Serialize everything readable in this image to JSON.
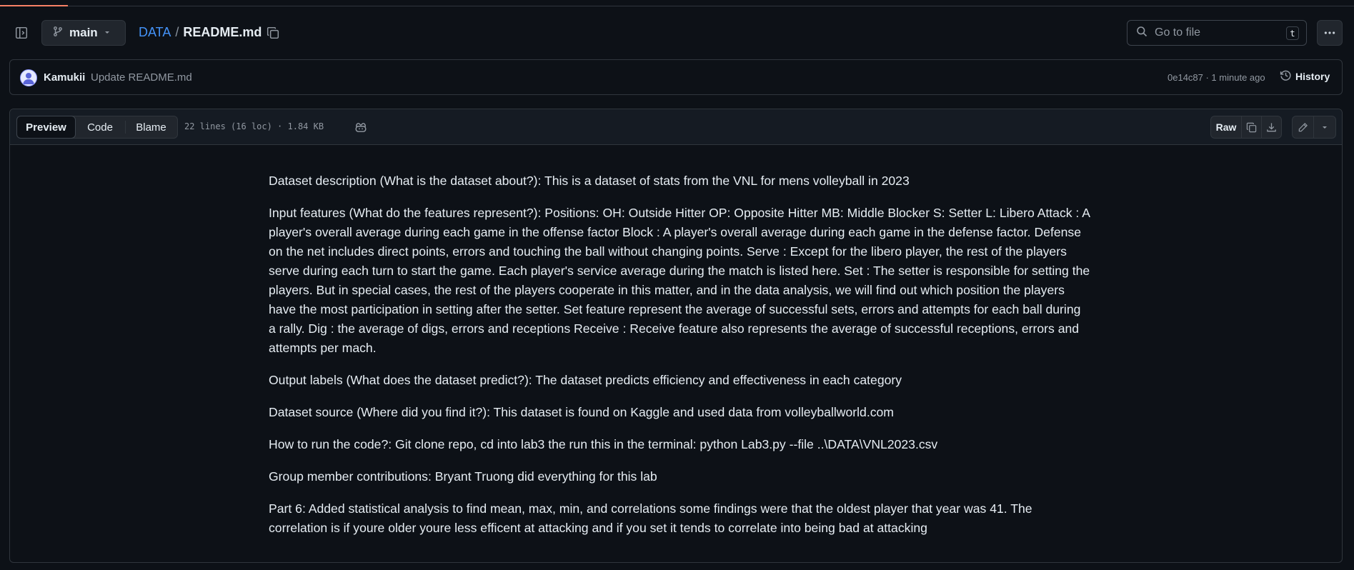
{
  "header": {
    "branch_label": "main",
    "breadcrumb": {
      "repo": "DATA",
      "separator": "/",
      "file": "README.md"
    },
    "search_placeholder": "Go to file",
    "search_shortcut": "t"
  },
  "commit": {
    "author": "Kamukii",
    "message": "Update README.md",
    "meta": "0e14c87 · 1 minute ago",
    "history_label": "History"
  },
  "file_toolbar": {
    "tabs": [
      "Preview",
      "Code",
      "Blame"
    ],
    "active_tab": "Preview",
    "file_info": "22 lines (16 loc) · 1.84 KB",
    "raw_label": "Raw"
  },
  "readme": {
    "paragraphs": [
      "Dataset description (What is the dataset about?): This is a dataset of stats from the VNL for mens volleyball in 2023",
      "Input features (What do the features represent?): Positions: OH: Outside Hitter OP: Opposite Hitter MB: Middle Blocker S: Setter L: Libero Attack : A player's overall average during each game in the offense factor Block : A player's overall average during each game in the defense factor. Defense on the net includes direct points, errors and touching the ball without changing points. Serve : Except for the libero player, the rest of the players serve during each turn to start the game. Each player's service average during the match is listed here. Set : The setter is responsible for setting the players. But in special cases, the rest of the players cooperate in this matter, and in the data analysis, we will find out which position the players have the most participation in setting after the setter. Set feature represent the average of successful sets, errors and attempts for each ball during a rally. Dig : the average of digs, errors and receptions Receive : Receive feature also represents the average of successful receptions, errors and attempts per mach.",
      "Output labels (What does the dataset predict?): The dataset predicts efficiency and effectiveness in each category",
      "Dataset source (Where did you find it?): This dataset is found on Kaggle and used data from volleyballworld.com",
      "How to run the code?: Git clone repo, cd into lab3 the run this in the terminal: python Lab3.py --file ..\\DATA\\VNL2023.csv",
      "Group member contributions: Bryant Truong did everything for this lab",
      "Part 6: Added statistical analysis to find mean, max, min, and correlations some findings were that the oldest player that year was 41. The correlation is if youre older youre less efficent at attacking and if you set it tends to correlate into being bad at attacking"
    ]
  },
  "icons": {
    "sidebar": "sidebar-expand-icon",
    "branch": "git-branch-icon",
    "copy": "copy-icon",
    "search": "search-icon",
    "more": "kebab-horizontal-icon",
    "history": "history-icon",
    "copilot": "copilot-icon",
    "download": "download-icon",
    "edit": "pencil-icon"
  },
  "colors": {
    "link": "#4493f8",
    "background": "#0d1117",
    "border": "#30363d",
    "accent": "#f78166"
  }
}
